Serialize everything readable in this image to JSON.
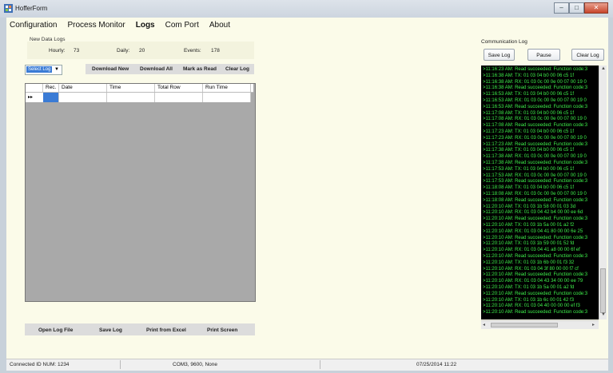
{
  "window": {
    "title": "HofferForm"
  },
  "menu": [
    "Configuration",
    "Process Monitor",
    "Logs",
    "Com Port",
    "About"
  ],
  "new_logs": {
    "title": "New Data Logs",
    "hourly_label": "Hourly:",
    "hourly": "73",
    "daily_label": "Daily:",
    "daily": "20",
    "events_label": "Events:",
    "events": "178"
  },
  "toolbar": {
    "select_log": "Select Log",
    "download_new": "Download New",
    "download_all": "Download All",
    "mark_read": "Mark as Read",
    "clear_log": "Clear Log"
  },
  "grid": {
    "columns": [
      "Rec.",
      "Date",
      "Time",
      "Total Row",
      "Run Time"
    ],
    "row_marker": "▸▸"
  },
  "bottom_buttons": [
    "Open Log File",
    "Save Log",
    "Print from Excel",
    "Print Screen"
  ],
  "comm": {
    "title": "Communication Log",
    "save": "Save Log",
    "pause": "Pause",
    "clear": "Clear Log",
    "lines": [
      ">11:16:23 AM: Read succeeded: Function code:3",
      ">11:16:38 AM: TX: 01 03 04 b0 00 06 c5 1f",
      ">11:16:38 AM: RX: 01 03 0c 00 0e 00 07 00 19 0",
      ">11:16:38 AM: Read succeeded: Function code:3",
      ">11:16:53 AM: TX: 01 03 04 b0 00 06 c5 1f",
      ">11:16:53 AM: RX: 01 03 0c 00 0e 00 07 00 19 0",
      ">11:16:53 AM: Read succeeded: Function code:3",
      ">11:17:08 AM: TX: 01 03 04 b0 00 06 c5 1f",
      ">11:17:08 AM: RX: 01 03 0c 00 0e 00 07 00 19 0",
      ">11:17:08 AM: Read succeeded: Function code:3",
      ">11:17:23 AM: TX: 01 03 04 b0 00 06 c5 1f",
      ">11:17:23 AM: RX: 01 03 0c 00 0e 00 07 00 19 0",
      ">11:17:23 AM: Read succeeded: Function code:3",
      ">11:17:38 AM: TX: 01 03 04 b0 00 06 c5 1f",
      ">11:17:38 AM: RX: 01 03 0c 00 0e 00 07 00 19 0",
      ">11:17:38 AM: Read succeeded: Function code:3",
      ">11:17:53 AM: TX: 01 03 04 b0 00 06 c5 1f",
      ">11:17:53 AM: RX: 01 03 0c 00 0e 00 07 00 19 0",
      ">11:17:53 AM: Read succeeded: Function code:3",
      ">11:18:08 AM: TX: 01 03 04 b0 00 06 c5 1f",
      ">11:18:08 AM: RX: 01 03 0c 00 0e 00 07 00 19 0",
      ">11:18:08 AM: Read succeeded: Function code:3",
      ">11:20:10 AM: TX: 01 03 1b 58 00 01 03 3d",
      ">11:20:10 AM: RX: 01 03 04 42 b4 00 00 ee 6d",
      ">11:20:10 AM: Read succeeded: Function code:3",
      ">11:20:10 AM: TX: 01 03 1b 5a 00 01 a2 f2",
      ">11:20:10 AM: RX: 01 03 04 41 80 00 00 6e 25",
      ">11:20:10 AM: Read succeeded: Function code:3",
      ">11:20:10 AM: TX: 01 03 1b 59 00 01 52 fd",
      ">11:20:10 AM: RX: 01 03 04 41 a8 00 00 6f ef",
      ">11:20:10 AM: Read succeeded: Function code:3",
      ">11:20:10 AM: TX: 01 03 1b 6b 00 01 f3 32",
      ">11:20:10 AM: RX: 01 03 04 3f 80 00 00 f7 cf",
      ">11:20:10 AM: Read succeeded: Function code:3",
      ">11:20:10 AM: RX: 01 03 04 43 34 00 00 ee 79",
      ">11:20:10 AM: TX: 01 03 1b 5a 00 01 a2 fd",
      ">11:20:10 AM: Read succeeded: Function code:3",
      ">11:20:10 AM: TX: 01 03 1b 6c 00 01 42 f3",
      ">11:20:10 AM: RX: 01 03 04 40 00 00 00 ef f3",
      ">11:20:10 AM: Read succeeded: Function code:3"
    ]
  },
  "status": {
    "connected": "Connected ID NUM: 1234",
    "port": "COM3, 9600, None",
    "datetime": "07/25/2014 11:22"
  }
}
